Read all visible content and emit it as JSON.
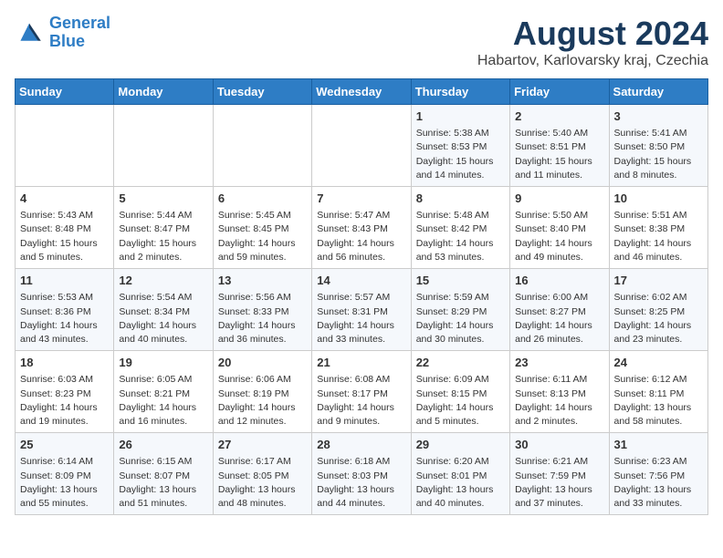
{
  "logo": {
    "line1": "General",
    "line2": "Blue"
  },
  "title": "August 2024",
  "subtitle": "Habartov, Karlovarsky kraj, Czechia",
  "days_of_week": [
    "Sunday",
    "Monday",
    "Tuesday",
    "Wednesday",
    "Thursday",
    "Friday",
    "Saturday"
  ],
  "weeks": [
    [
      {
        "day": "",
        "info": ""
      },
      {
        "day": "",
        "info": ""
      },
      {
        "day": "",
        "info": ""
      },
      {
        "day": "",
        "info": ""
      },
      {
        "day": "1",
        "info": "Sunrise: 5:38 AM\nSunset: 8:53 PM\nDaylight: 15 hours\nand 14 minutes."
      },
      {
        "day": "2",
        "info": "Sunrise: 5:40 AM\nSunset: 8:51 PM\nDaylight: 15 hours\nand 11 minutes."
      },
      {
        "day": "3",
        "info": "Sunrise: 5:41 AM\nSunset: 8:50 PM\nDaylight: 15 hours\nand 8 minutes."
      }
    ],
    [
      {
        "day": "4",
        "info": "Sunrise: 5:43 AM\nSunset: 8:48 PM\nDaylight: 15 hours\nand 5 minutes."
      },
      {
        "day": "5",
        "info": "Sunrise: 5:44 AM\nSunset: 8:47 PM\nDaylight: 15 hours\nand 2 minutes."
      },
      {
        "day": "6",
        "info": "Sunrise: 5:45 AM\nSunset: 8:45 PM\nDaylight: 14 hours\nand 59 minutes."
      },
      {
        "day": "7",
        "info": "Sunrise: 5:47 AM\nSunset: 8:43 PM\nDaylight: 14 hours\nand 56 minutes."
      },
      {
        "day": "8",
        "info": "Sunrise: 5:48 AM\nSunset: 8:42 PM\nDaylight: 14 hours\nand 53 minutes."
      },
      {
        "day": "9",
        "info": "Sunrise: 5:50 AM\nSunset: 8:40 PM\nDaylight: 14 hours\nand 49 minutes."
      },
      {
        "day": "10",
        "info": "Sunrise: 5:51 AM\nSunset: 8:38 PM\nDaylight: 14 hours\nand 46 minutes."
      }
    ],
    [
      {
        "day": "11",
        "info": "Sunrise: 5:53 AM\nSunset: 8:36 PM\nDaylight: 14 hours\nand 43 minutes."
      },
      {
        "day": "12",
        "info": "Sunrise: 5:54 AM\nSunset: 8:34 PM\nDaylight: 14 hours\nand 40 minutes."
      },
      {
        "day": "13",
        "info": "Sunrise: 5:56 AM\nSunset: 8:33 PM\nDaylight: 14 hours\nand 36 minutes."
      },
      {
        "day": "14",
        "info": "Sunrise: 5:57 AM\nSunset: 8:31 PM\nDaylight: 14 hours\nand 33 minutes."
      },
      {
        "day": "15",
        "info": "Sunrise: 5:59 AM\nSunset: 8:29 PM\nDaylight: 14 hours\nand 30 minutes."
      },
      {
        "day": "16",
        "info": "Sunrise: 6:00 AM\nSunset: 8:27 PM\nDaylight: 14 hours\nand 26 minutes."
      },
      {
        "day": "17",
        "info": "Sunrise: 6:02 AM\nSunset: 8:25 PM\nDaylight: 14 hours\nand 23 minutes."
      }
    ],
    [
      {
        "day": "18",
        "info": "Sunrise: 6:03 AM\nSunset: 8:23 PM\nDaylight: 14 hours\nand 19 minutes."
      },
      {
        "day": "19",
        "info": "Sunrise: 6:05 AM\nSunset: 8:21 PM\nDaylight: 14 hours\nand 16 minutes."
      },
      {
        "day": "20",
        "info": "Sunrise: 6:06 AM\nSunset: 8:19 PM\nDaylight: 14 hours\nand 12 minutes."
      },
      {
        "day": "21",
        "info": "Sunrise: 6:08 AM\nSunset: 8:17 PM\nDaylight: 14 hours\nand 9 minutes."
      },
      {
        "day": "22",
        "info": "Sunrise: 6:09 AM\nSunset: 8:15 PM\nDaylight: 14 hours\nand 5 minutes."
      },
      {
        "day": "23",
        "info": "Sunrise: 6:11 AM\nSunset: 8:13 PM\nDaylight: 14 hours\nand 2 minutes."
      },
      {
        "day": "24",
        "info": "Sunrise: 6:12 AM\nSunset: 8:11 PM\nDaylight: 13 hours\nand 58 minutes."
      }
    ],
    [
      {
        "day": "25",
        "info": "Sunrise: 6:14 AM\nSunset: 8:09 PM\nDaylight: 13 hours\nand 55 minutes."
      },
      {
        "day": "26",
        "info": "Sunrise: 6:15 AM\nSunset: 8:07 PM\nDaylight: 13 hours\nand 51 minutes."
      },
      {
        "day": "27",
        "info": "Sunrise: 6:17 AM\nSunset: 8:05 PM\nDaylight: 13 hours\nand 48 minutes."
      },
      {
        "day": "28",
        "info": "Sunrise: 6:18 AM\nSunset: 8:03 PM\nDaylight: 13 hours\nand 44 minutes."
      },
      {
        "day": "29",
        "info": "Sunrise: 6:20 AM\nSunset: 8:01 PM\nDaylight: 13 hours\nand 40 minutes."
      },
      {
        "day": "30",
        "info": "Sunrise: 6:21 AM\nSunset: 7:59 PM\nDaylight: 13 hours\nand 37 minutes."
      },
      {
        "day": "31",
        "info": "Sunrise: 6:23 AM\nSunset: 7:56 PM\nDaylight: 13 hours\nand 33 minutes."
      }
    ]
  ]
}
